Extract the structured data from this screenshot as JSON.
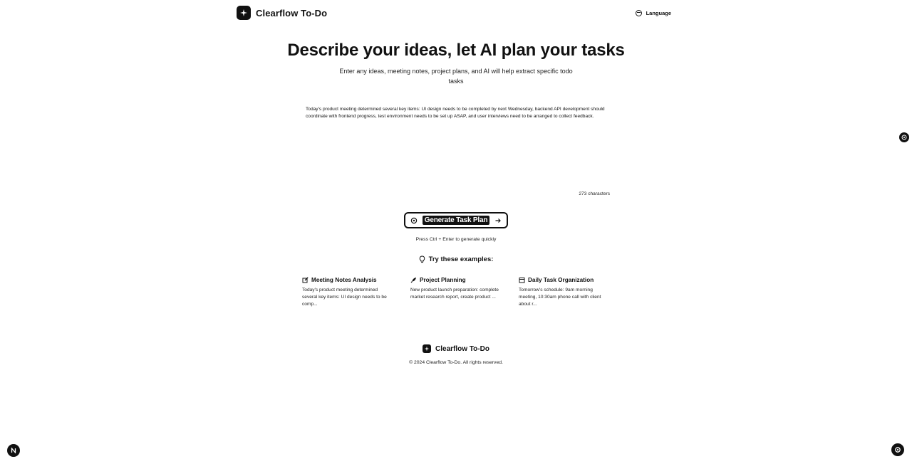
{
  "header": {
    "brand_name": "Clearflow To-Do",
    "language_label": "Language"
  },
  "hero": {
    "title": "Describe your ideas, let AI plan your tasks",
    "subtitle": "Enter any ideas, meeting notes, project plans, and AI will help extract specific todo tasks"
  },
  "input": {
    "value": "Today's product meeting determined several key items: UI design needs to be completed by next Wednesday, backend API development should coordinate with frontend progress, test environment needs to be set up ASAP, and user interviews need to be arranged to collect feedback.",
    "char_count": "273 characters"
  },
  "actions": {
    "generate_label": "Generate Task Plan",
    "hint": "Press Ctrl + Enter to generate quickly"
  },
  "examples": {
    "title": "Try these examples:",
    "items": [
      {
        "icon": "memo-icon",
        "title": "Meeting Notes Analysis",
        "preview": "Today's product meeting determined several key items: UI design needs to be comp..."
      },
      {
        "icon": "rocket-icon",
        "title": "Project Planning",
        "preview": "New product launch preparation: complete market research report, create product ..."
      },
      {
        "icon": "calendar-icon",
        "title": "Daily Task Organization",
        "preview": "Tomorrow's schedule: 9am morning meeting, 10:30am phone call with client about r..."
      }
    ]
  },
  "footer": {
    "brand_name": "Clearflow To-Do",
    "copyright": "© 2024 Clearflow To-Do. All rights reserved."
  },
  "colors": {
    "text": "#111111",
    "background": "#ffffff",
    "accent": "#111111"
  }
}
